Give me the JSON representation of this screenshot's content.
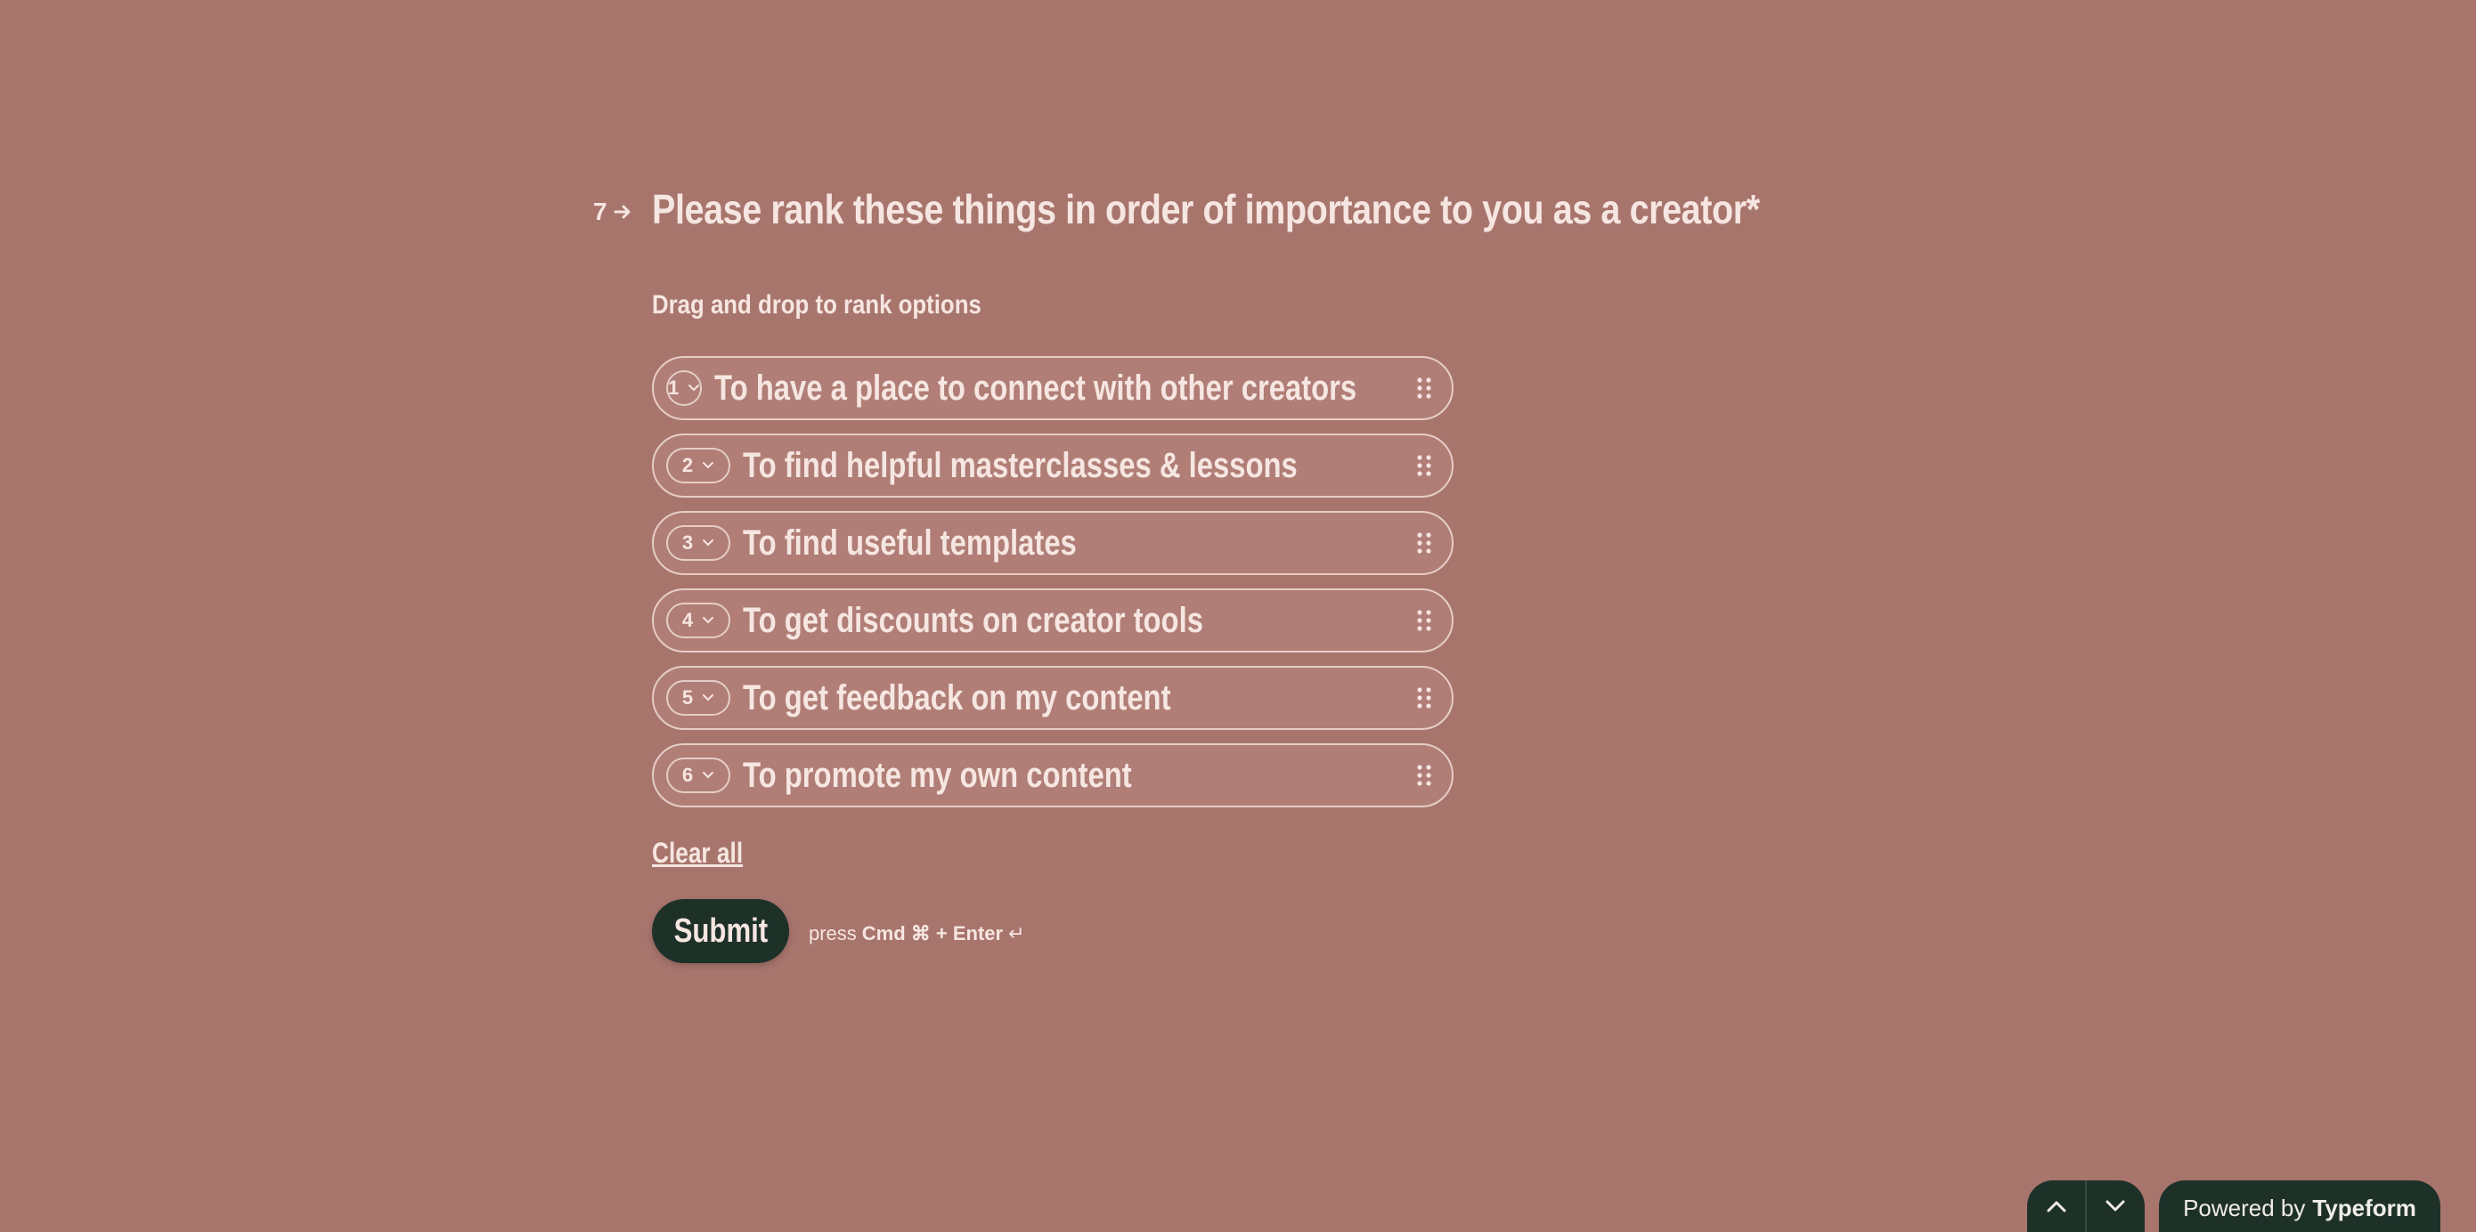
{
  "question": {
    "number": "7",
    "title": "Please rank these things in order of importance to you as a creator*",
    "instruction": "Drag and drop to rank options"
  },
  "options": [
    {
      "rank": "1",
      "label": "To have a place to connect with other creators"
    },
    {
      "rank": "2",
      "label": "To find helpful masterclasses & lessons"
    },
    {
      "rank": "3",
      "label": "To find useful templates"
    },
    {
      "rank": "4",
      "label": "To get discounts on creator tools"
    },
    {
      "rank": "5",
      "label": "To get feedback on my content"
    },
    {
      "rank": "6",
      "label": "To promote my own content"
    }
  ],
  "actions": {
    "clear_all": "Clear all",
    "submit": "Submit",
    "hint_press": "press",
    "hint_keys": "Cmd ⌘ + Enter",
    "hint_enter_symbol": "↵"
  },
  "footer": {
    "powered_by": "Powered by",
    "brand": "Typeform"
  },
  "icons": {
    "question_arrow": "arrow-right-icon",
    "rank_dropdown": "chevron-down-icon",
    "drag": "drag-handle-icon",
    "nav_up": "chevron-up-icon",
    "nav_down": "chevron-down-icon"
  },
  "colors": {
    "background": "#a8756d",
    "option_fill": "#b07e76",
    "text": "#f6e6e1",
    "button": "#1e3129"
  }
}
